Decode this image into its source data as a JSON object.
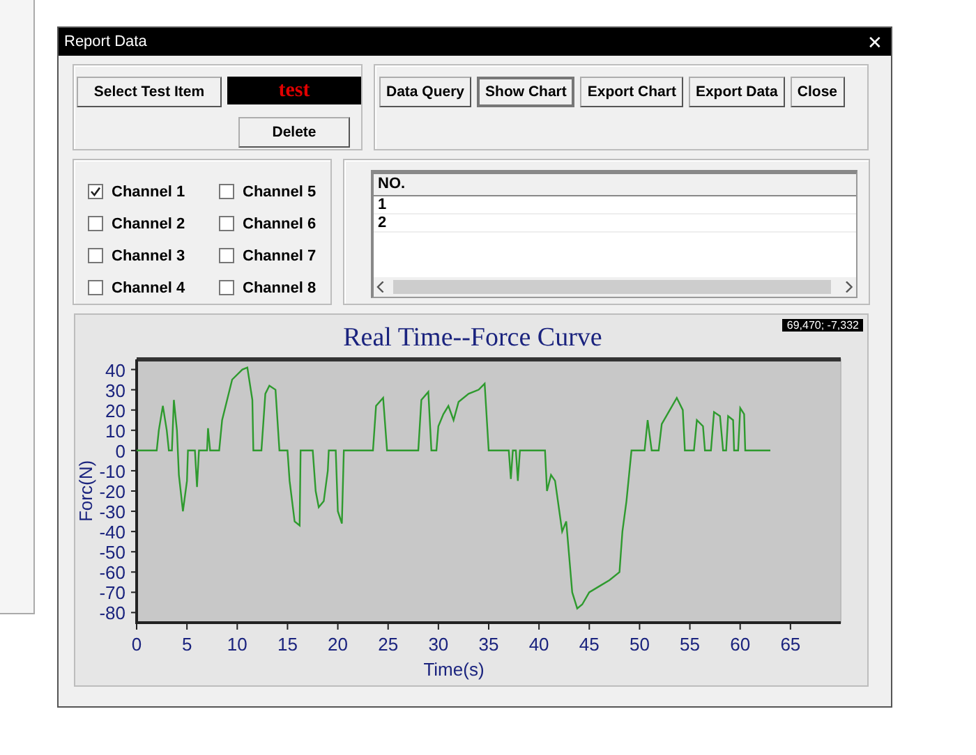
{
  "window": {
    "title": "Report Data",
    "close": "✕"
  },
  "test_item": {
    "button": "Select Test Item",
    "value": "test",
    "delete_button": "Delete"
  },
  "actions": [
    {
      "label": "Data Query",
      "selected": false
    },
    {
      "label": "Show Chart",
      "selected": true
    },
    {
      "label": "Export Chart",
      "selected": false
    },
    {
      "label": "Export Data",
      "selected": false
    },
    {
      "label": "Close",
      "selected": false
    }
  ],
  "channels": [
    {
      "label": "Channel 1",
      "checked": true
    },
    {
      "label": "Channel 2",
      "checked": false
    },
    {
      "label": "Channel 3",
      "checked": false
    },
    {
      "label": "Channel 4",
      "checked": false
    },
    {
      "label": "Channel 5",
      "checked": false
    },
    {
      "label": "Channel 6",
      "checked": false
    },
    {
      "label": "Channel 7",
      "checked": false
    },
    {
      "label": "Channel 8",
      "checked": false
    }
  ],
  "table": {
    "columns": [
      "NO."
    ],
    "rows": [
      [
        "1"
      ],
      [
        "2"
      ]
    ]
  },
  "chart": {
    "cursor_readout": "69,470; -7,332",
    "chart_data": {
      "type": "line",
      "title": "Real Time--Force Curve",
      "xlabel": "Time(s)",
      "ylabel": "Forc(N)",
      "x": [
        0,
        2,
        2.2,
        2.6,
        3,
        3.2,
        3.5,
        3.7,
        4,
        4.2,
        4.6,
        5,
        5.1,
        5.8,
        6,
        6.2,
        7,
        7.1,
        7.3,
        8.2,
        8.5,
        9.5,
        10.5,
        11,
        11.5,
        11.6,
        12.4,
        12.8,
        13.2,
        13.8,
        14.2,
        15,
        15.2,
        15.7,
        16.2,
        16.3,
        17.5,
        17.8,
        18.1,
        18.6,
        19,
        19.1,
        19.8,
        20,
        20.4,
        20.6,
        23.5,
        23.8,
        24.5,
        24.9,
        28,
        28.3,
        29,
        29.3,
        29.8,
        30,
        30.5,
        31,
        31.5,
        32,
        33,
        34,
        34.6,
        35,
        37,
        37.2,
        37.4,
        37.7,
        37.9,
        38.1,
        40.6,
        40.8,
        41.2,
        41.6,
        42.3,
        42.7,
        43.3,
        43.8,
        44.3,
        45,
        46,
        47,
        48,
        48.3,
        48.7,
        49.2,
        50.5,
        50.8,
        51.2,
        51.9,
        52.2,
        53,
        53.7,
        54.3,
        54.5,
        55.4,
        55.7,
        56.3,
        56.5,
        57.1,
        57.4,
        58,
        58.3,
        58.6,
        58.8,
        59.3,
        59.4,
        59.8,
        60,
        60.4,
        60.5,
        63
      ],
      "series": [
        {
          "color": "#2e9a2e",
          "values": [
            0,
            0,
            10,
            22,
            10,
            0,
            0,
            25,
            10,
            -12,
            -30,
            -15,
            0,
            0,
            -18,
            0,
            0,
            11,
            0,
            0,
            15,
            35,
            40,
            41,
            25,
            0,
            0,
            28,
            32,
            30,
            0,
            0,
            -15,
            -35,
            -37,
            0,
            0,
            -20,
            -28,
            -25,
            -10,
            0,
            0,
            -30,
            -36,
            0,
            0,
            22,
            26,
            0,
            0,
            25,
            29,
            0,
            0,
            12,
            18,
            22,
            15,
            24,
            28,
            30,
            33,
            0,
            0,
            -14,
            0,
            0,
            -15,
            0,
            0,
            -20,
            -12,
            -15,
            -40,
            -35,
            -70,
            -78,
            -76,
            -70,
            -67,
            -64,
            -60,
            -40,
            -25,
            0,
            0,
            15,
            0,
            0,
            13,
            20,
            26,
            20,
            0,
            0,
            15,
            12,
            0,
            0,
            19,
            17,
            0,
            0,
            17,
            15,
            0,
            0,
            21,
            18,
            0,
            0
          ]
        }
      ],
      "xlim": [
        0,
        70
      ],
      "ylim": [
        -85,
        45
      ],
      "xticks": [
        0,
        5,
        10,
        15,
        20,
        25,
        30,
        35,
        40,
        45,
        50,
        55,
        60,
        65
      ],
      "yticks": [
        40,
        30,
        20,
        10,
        0,
        -10,
        -20,
        -30,
        -40,
        -50,
        -60,
        -70,
        -80
      ]
    }
  }
}
